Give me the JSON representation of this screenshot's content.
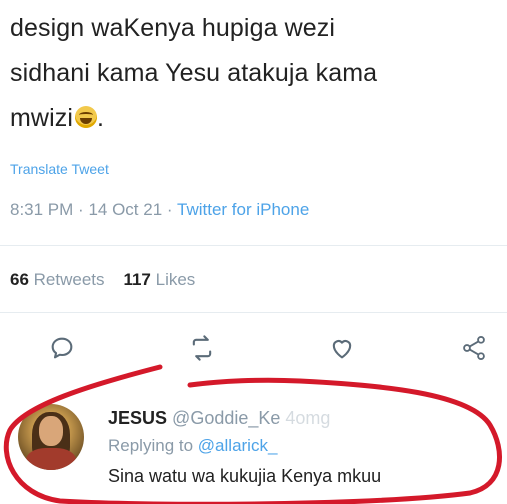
{
  "tweet": {
    "text_line1": "design waKenya hupiga wezi",
    "text_line2": "sidhani kama Yesu atakuja kama",
    "text_line3": "mwizi",
    "text_end": ".",
    "emoji": "laughing-tears-emoji",
    "translate_label": "Translate Tweet",
    "time": "8:31 PM",
    "date": "14 Oct 21",
    "separator": "·",
    "source": "Twitter for iPhone",
    "retweets_count": "66",
    "retweets_label": "Retweets",
    "likes_count": "117",
    "likes_label": "Likes"
  },
  "actions": [
    {
      "name": "reply-icon"
    },
    {
      "name": "retweet-icon"
    },
    {
      "name": "like-icon"
    },
    {
      "name": "share-icon"
    }
  ],
  "reply": {
    "name": "JESUS",
    "handle": "@Goddie_Ke",
    "handle_extra": "4omg",
    "replying_prefix": "Replying to",
    "replying_to": "@allarick_",
    "text": "Sina watu wa kukujia Kenya mkuu"
  },
  "colors": {
    "accent": "#4da3e8",
    "muted": "#8a9aa8",
    "annotation": "#d4192a"
  }
}
